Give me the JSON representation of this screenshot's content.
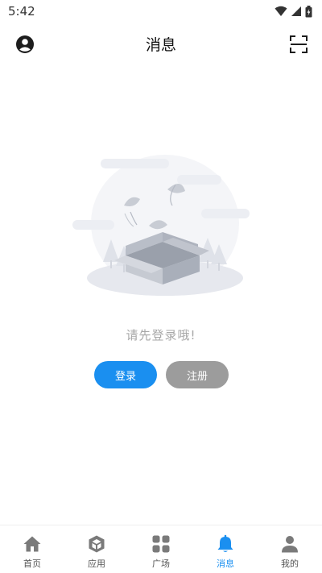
{
  "status_bar": {
    "time": "5:42"
  },
  "header": {
    "title": "消息"
  },
  "empty_state": {
    "message": "请先登录哦!",
    "login_label": "登录",
    "register_label": "注册"
  },
  "tabs": [
    {
      "label": "首页",
      "icon": "home-icon",
      "active": false
    },
    {
      "label": "应用",
      "icon": "cube-icon",
      "active": false
    },
    {
      "label": "广场",
      "icon": "grid-icon",
      "active": false
    },
    {
      "label": "消息",
      "icon": "bell-icon",
      "active": true
    },
    {
      "label": "我的",
      "icon": "person-icon",
      "active": false
    }
  ],
  "colors": {
    "accent": "#1a8ff0",
    "inactive_icon": "#7a7a7a",
    "register_button": "#9c9c9c"
  }
}
